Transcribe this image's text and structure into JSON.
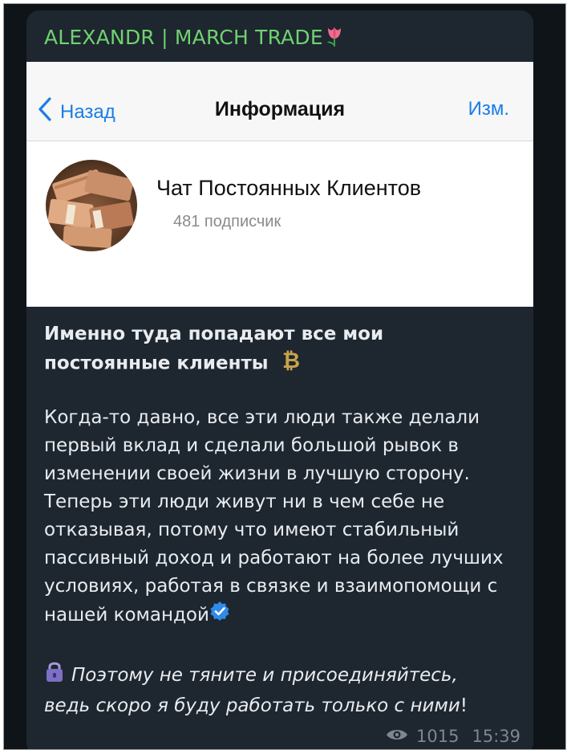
{
  "message": {
    "sender_name": "ALEXANDR | MARCH TRADE",
    "sender_emoji": "tulip-icon",
    "headline_line1": "Именно туда попадают все мои",
    "headline_line2": "постоянные клиенты",
    "headline_emoji": "bitcoin-icon",
    "body_lines": [
      "Когда-то давно, все эти люди также делали",
      "первый вклад и сделали большой рывок в",
      "изменении своей жизни в лучшую сторону.",
      "Теперь эти люди живут ни в чем себе не",
      "отказывая, потому что имеют стабильный",
      "пассивный доход и работают на более лучших",
      "условиях, работая в связке и взаимопомощи с",
      "нашей командой"
    ],
    "body_end_emoji": "verified-check-icon",
    "italic_emoji": "lock-icon",
    "italic_line1": "Поэтому не тяните и присоединяйтесь,",
    "italic_line2": "ведь скоро я буду работать только с ними",
    "italic_tail": "!",
    "views": "1015",
    "time": "15:39",
    "views_icon": "eye-icon"
  },
  "screenshot": {
    "back_label": "Назад",
    "title": "Информация",
    "edit_label": "Изм.",
    "channel_name": "Чат Постоянных Клиентов",
    "subscribers": "481 подписчик",
    "accent_color": "#1a7ee6"
  },
  "colors": {
    "bubble": "#1e2630",
    "sender": "#6fd26f",
    "text": "#e8ecef",
    "meta": "#7c8791"
  }
}
